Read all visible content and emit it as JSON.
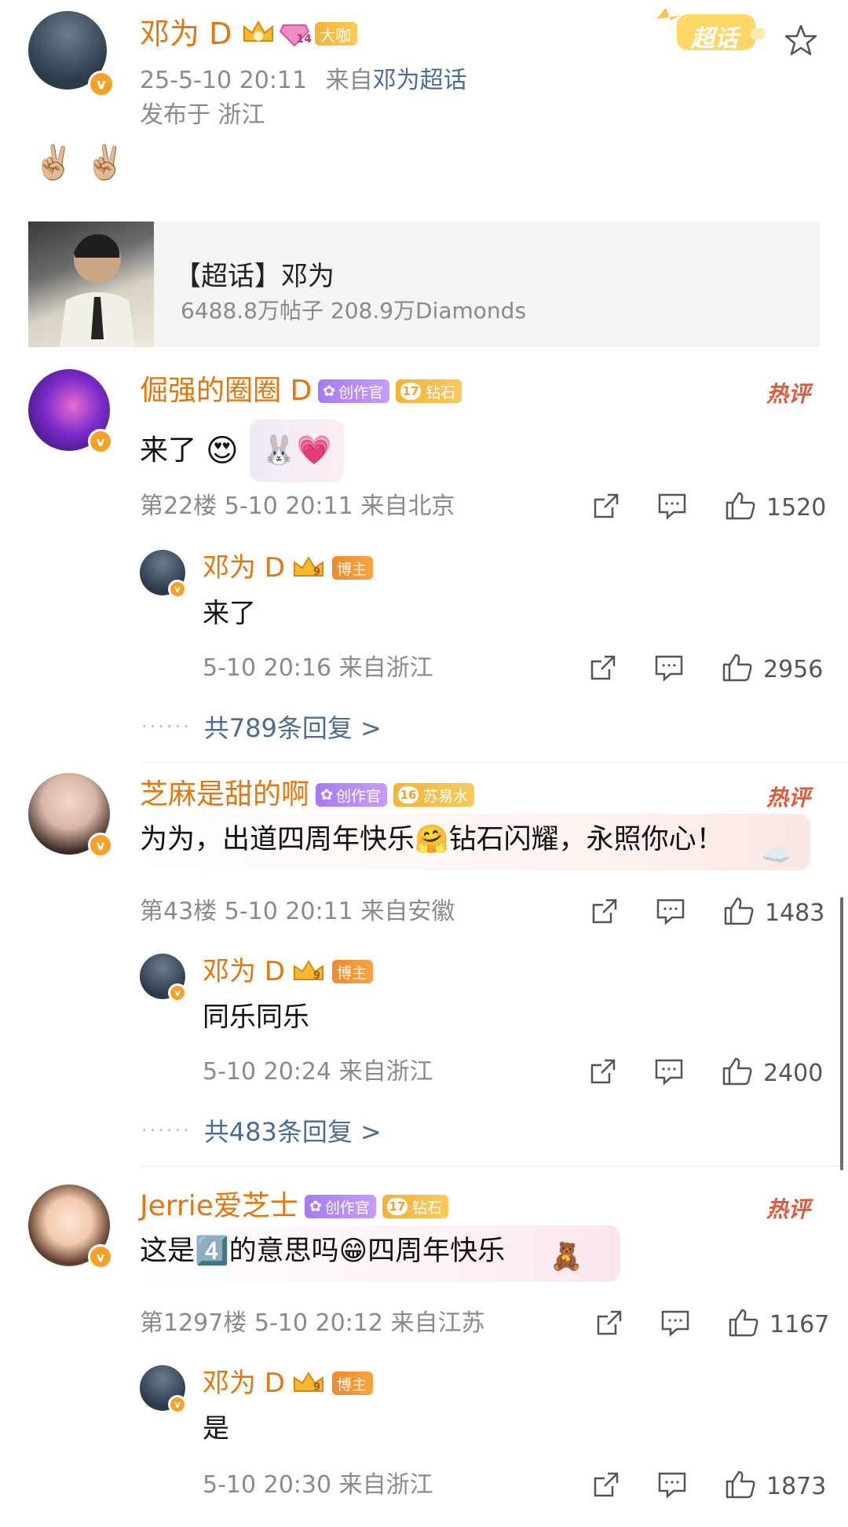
{
  "post": {
    "author": "邓为 D",
    "level_badge": "14",
    "role_badge": "大咖",
    "date": "25-5-10 20:11",
    "from_label": "来自",
    "source": "邓为超话",
    "location": "发布于 浙江",
    "content": "✌🏼 ✌🏼",
    "supertopic_sticker": "超话",
    "card": {
      "title": "【超话】邓为",
      "stats": "6488.8万帖子  208.9万Diamonds"
    }
  },
  "comments": [
    {
      "name": "倔强的圈圈 D",
      "tags": [
        {
          "text": "创作官",
          "type": "purple",
          "num": ""
        },
        {
          "text": "钻石",
          "type": "gold",
          "num": "17"
        }
      ],
      "hot": "热评",
      "text": "来了",
      "meta": "第22楼  5-10 20:11  来自北京",
      "likes": "1520",
      "reply": {
        "name": "邓为 D",
        "tag": "博主",
        "level": "9",
        "text": "来了",
        "meta": "5-10 20:16  来自浙江",
        "likes": "2956"
      },
      "more": "共789条回复 >"
    },
    {
      "name": "芝麻是甜的啊",
      "tags": [
        {
          "text": "创作官",
          "type": "purple",
          "num": ""
        },
        {
          "text": "苏易水",
          "type": "gold",
          "num": "16"
        }
      ],
      "hot": "热评",
      "text": "为为，出道四周年快乐🤗钻石闪耀，永照你心！",
      "meta": "第43楼  5-10 20:11  来自安徽",
      "likes": "1483",
      "reply": {
        "name": "邓为 D",
        "tag": "博主",
        "level": "9",
        "text": "同乐同乐",
        "meta": "5-10 20:24  来自浙江",
        "likes": "2400"
      },
      "more": "共483条回复 >"
    },
    {
      "name": "Jerrie爱芝士",
      "tags": [
        {
          "text": "创作官",
          "type": "purple",
          "num": ""
        },
        {
          "text": "钻石",
          "type": "gold",
          "num": "17"
        }
      ],
      "hot": "热评",
      "text": "这是4️⃣的意思吗😁四周年快乐",
      "meta": "第1297楼  5-10 20:12  来自江苏",
      "likes": "1167",
      "reply": {
        "name": "邓为 D",
        "tag": "博主",
        "level": "9",
        "text": "是",
        "meta": "5-10 20:30  来自浙江",
        "likes": "1873"
      }
    }
  ],
  "colors": {
    "name": "#e4760d",
    "link": "#4a6c9a",
    "meta": "#8a8a8a",
    "hot": "#e05a3a"
  },
  "icons": {
    "share": "share-icon",
    "comment": "comment-icon",
    "like": "thumbs-up-icon",
    "star": "star-icon"
  }
}
